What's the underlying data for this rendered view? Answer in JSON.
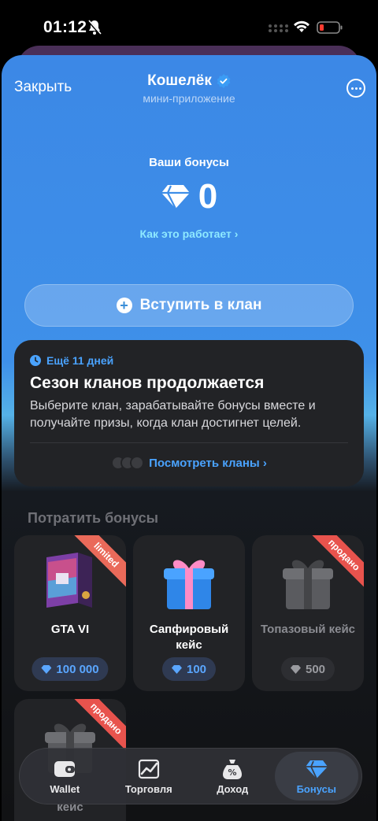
{
  "status": {
    "time": "01:12"
  },
  "header": {
    "close_label": "Закрыть",
    "title": "Кошелёк",
    "subtitle": "мини-приложение"
  },
  "bonus": {
    "label": "Ваши бонусы",
    "value": "0",
    "how_link": "Как это работает ›"
  },
  "join_button": "Вступить в клан",
  "clan_card": {
    "badge": "Ещё 11 дней",
    "title": "Сезон кланов продолжается",
    "description": "Выберите клан, зарабатывайте бонусы вместе и получайте призы, когда клан достигнет целей.",
    "link": "Посмотреть кланы ›"
  },
  "spend_section": {
    "title": "Потратить бонусы",
    "items": [
      {
        "name": "GTA VI",
        "price": "100 000",
        "ribbon": "limited",
        "state": "active"
      },
      {
        "name": "Сапфировый кейс",
        "price": "100",
        "ribbon": "",
        "state": "active"
      },
      {
        "name": "Топазовый кейс",
        "price": "500",
        "ribbon": "продано",
        "state": "sold"
      },
      {
        "name": "кейс",
        "price": "",
        "ribbon": "продано",
        "state": "sold"
      }
    ]
  },
  "tab_bar": [
    {
      "label": "Wallet",
      "icon": "wallet-icon",
      "active": false
    },
    {
      "label": "Торговля",
      "icon": "chart-icon",
      "active": false
    },
    {
      "label": "Доход",
      "icon": "percent-bag-icon",
      "active": false
    },
    {
      "label": "Бонусы",
      "icon": "diamond-icon",
      "active": true
    }
  ],
  "colors": {
    "accent": "#4aa3ff",
    "sold_ribbon": "#e8534d",
    "header_blue": "#3c88e6"
  }
}
